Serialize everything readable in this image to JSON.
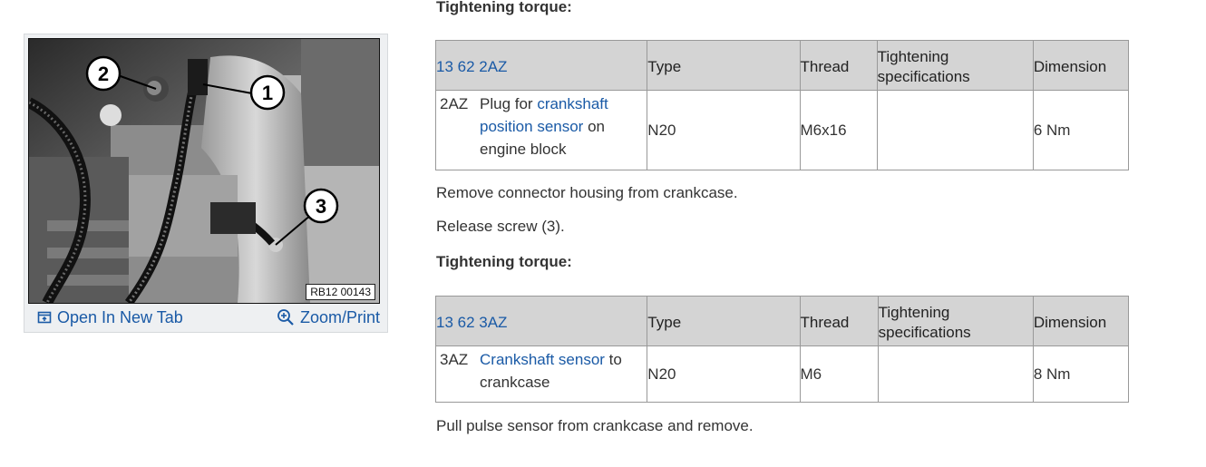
{
  "figure": {
    "code": "RB12 00143",
    "callouts": [
      "1",
      "2",
      "3"
    ],
    "open_tab_label": "Open In New Tab",
    "open_tab_icon": "open-new-tab-icon",
    "zoom_label": "Zoom/Print",
    "zoom_icon": "zoom-icon"
  },
  "section1": {
    "heading": "Tightening torque:",
    "table": {
      "headers": {
        "code": "13 62 2AZ",
        "type": "Type",
        "thread": "Thread",
        "spec": "Tightening specifications",
        "dimension": "Dimension"
      },
      "row": {
        "code": "2AZ",
        "desc_pre": "Plug for ",
        "desc_link": "crankshaft position sensor",
        "desc_post": " on engine block",
        "type": "N20",
        "thread": "M6x16",
        "spec": "",
        "dimension": "6 Nm"
      }
    }
  },
  "steps": {
    "step1": "Remove connector housing from crankcase.",
    "step2": "Release screw (3)."
  },
  "section2": {
    "heading": "Tightening torque:",
    "table": {
      "headers": {
        "code": "13 62 3AZ",
        "type": "Type",
        "thread": "Thread",
        "spec": "Tightening specifications",
        "dimension": "Dimension"
      },
      "row": {
        "code": "3AZ",
        "desc_pre": "",
        "desc_link": "Crankshaft sensor",
        "desc_post": " to crankcase",
        "type": "N20",
        "thread": "M6",
        "spec": "",
        "dimension": "8 Nm"
      }
    }
  },
  "final_step": "Pull pulse sensor from crankcase and remove.",
  "colors": {
    "link": "#1a5aa6",
    "header_bg": "#d4d4d4",
    "text": "#333333"
  }
}
